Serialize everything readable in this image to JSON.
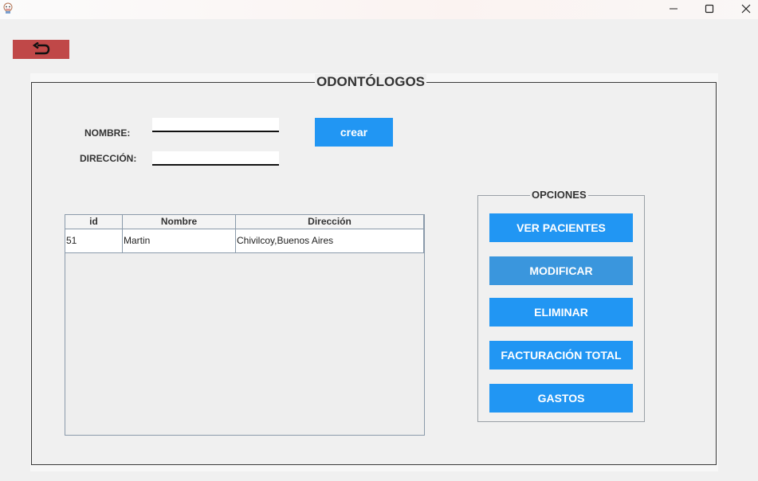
{
  "window": {
    "controls": {
      "minimize_icon": "minimize-icon",
      "maximize_icon": "maximize-icon",
      "close_icon": "close-icon"
    }
  },
  "toolbar": {
    "back_icon": "back-arrow-icon",
    "back_color": "#c04848"
  },
  "panel": {
    "title": "ODONTÓLOGOS",
    "form": {
      "nombre_label": "NOMBRE:",
      "nombre_value": "",
      "direccion_label": "DIRECCIÓN:",
      "direccion_value": "",
      "create_label": "crear"
    },
    "table": {
      "columns": [
        "id",
        "Nombre",
        "Dirección"
      ],
      "rows": [
        [
          "51",
          "Martin",
          "Chivilcoy,Buenos Aires"
        ]
      ]
    },
    "options": {
      "title": "OPCIONES",
      "buttons": [
        "VER PACIENTES",
        "MODIFICAR",
        "ELIMINAR",
        "FACTURACIÓN TOTAL",
        "GASTOS"
      ]
    }
  },
  "colors": {
    "accent": "#2196f3",
    "accent_hover": "#3a96dd"
  }
}
